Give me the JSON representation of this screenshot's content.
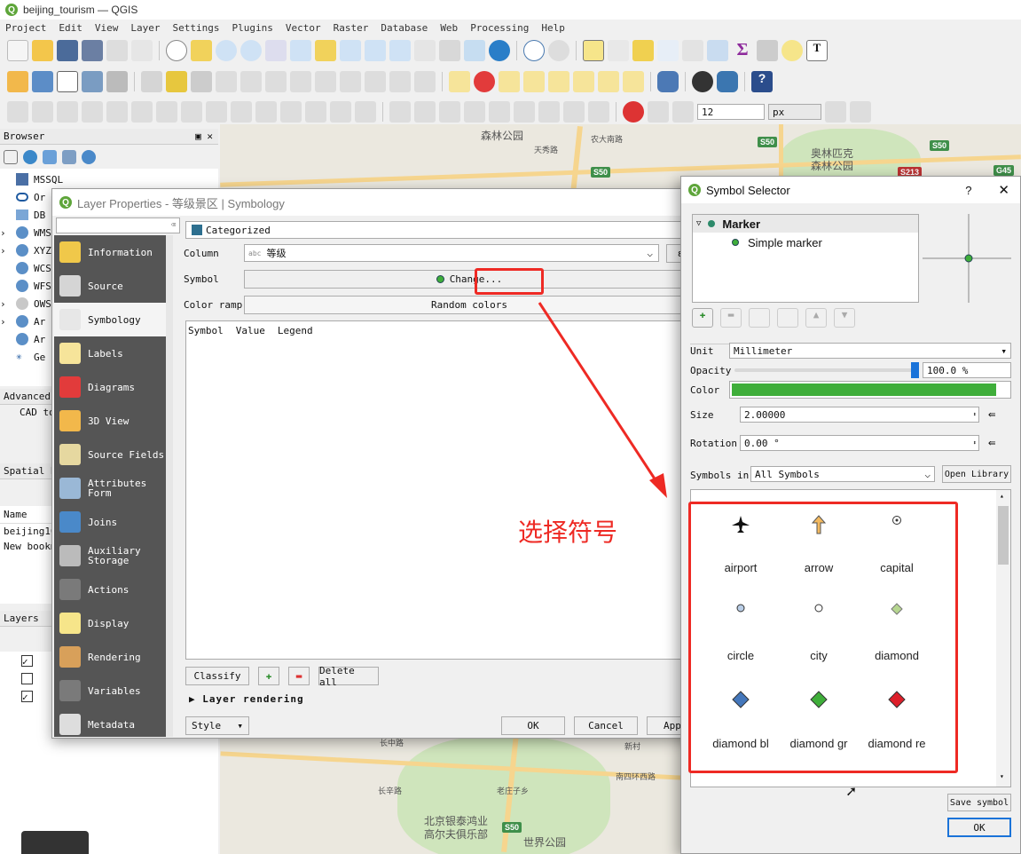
{
  "window": {
    "title": "beijing_tourism — QGIS"
  },
  "menu": [
    "Project",
    "Edit",
    "View",
    "Layer",
    "Settings",
    "Plugins",
    "Vector",
    "Raster",
    "Database",
    "Web",
    "Processing",
    "Help"
  ],
  "toolbar": {
    "snap_tolerance": "12",
    "snap_unit": "px"
  },
  "map_labels": [
    "森林公园",
    "天秀路",
    "农大南路",
    "奥林匹克",
    "森林公园",
    "S50",
    "S50",
    "S50",
    "G45",
    "S213",
    "长中路",
    "新村",
    "南四环西路",
    "长辛路",
    "老庄子乡",
    "北京银泰鸿业",
    "高尔夫俱乐部",
    "S50",
    "世界公园"
  ],
  "browser": {
    "header": "Browser",
    "items": [
      "MSSQL",
      "Or",
      "DB",
      "WMS",
      "XYZ",
      "WCS",
      "WFS",
      "OWS",
      "Ar",
      "Ar",
      "Ge"
    ]
  },
  "advanced": {
    "header": "Advanced",
    "item": "CAD to"
  },
  "spatial": {
    "header": "Spatial B",
    "col_name": "Name",
    "rows": [
      "beijing10",
      "New bookm"
    ]
  },
  "layers": {
    "header": "Layers"
  },
  "layer_props": {
    "title": "Layer Properties - 等级景区 | Symbology",
    "sidebar": [
      {
        "label": "Information",
        "icon": "info-icon"
      },
      {
        "label": "Source",
        "icon": "source-icon"
      },
      {
        "label": "Symbology",
        "icon": "symbology-icon"
      },
      {
        "label": "Labels",
        "icon": "labels-icon"
      },
      {
        "label": "Diagrams",
        "icon": "diagrams-icon"
      },
      {
        "label": "3D View",
        "icon": "cube-icon"
      },
      {
        "label": "Source Fields",
        "icon": "fields-icon"
      },
      {
        "label": "Attributes\nForm",
        "icon": "form-icon"
      },
      {
        "label": "Joins",
        "icon": "joins-icon"
      },
      {
        "label": "Auxiliary\nStorage",
        "icon": "storage-icon"
      },
      {
        "label": "Actions",
        "icon": "actions-icon"
      },
      {
        "label": "Display",
        "icon": "display-icon"
      },
      {
        "label": "Rendering",
        "icon": "rendering-icon"
      },
      {
        "label": "Variables",
        "icon": "variables-icon"
      },
      {
        "label": "Metadata",
        "icon": "metadata-icon"
      }
    ],
    "renderer": "Categorized",
    "column_label": "Column",
    "column_value": "等级",
    "column_type": "abc",
    "symbol_label": "Symbol",
    "change_button": "Change...",
    "color_ramp_label": "Color ramp",
    "color_ramp_value": "Random colors",
    "table_headers": [
      "Symbol",
      "Value",
      "Legend"
    ],
    "classify": "Classify",
    "delete_all": "Delete all",
    "layer_rendering": "Layer rendering",
    "style": "Style",
    "ok": "OK",
    "cancel": "Cancel",
    "apply": "Apply"
  },
  "annotation": "选择符号",
  "symbol_selector": {
    "title": "Symbol Selector",
    "help": "?",
    "tree_root": "Marker",
    "tree_child": "Simple marker",
    "unit_label": "Unit",
    "unit_value": "Millimeter",
    "opacity_label": "Opacity",
    "opacity_value": "100.0 %",
    "opacity_level": 1.0,
    "color_label": "Color",
    "color_value": "#3fae3a",
    "size_label": "Size",
    "size_value": "2.00000",
    "rotation_label": "Rotation",
    "rotation_value": "0.00 °",
    "symbols_in_label": "Symbols in",
    "symbols_in_value": "All Symbols",
    "open_library": "Open Library",
    "symbols": [
      {
        "name": "airport"
      },
      {
        "name": "arrow"
      },
      {
        "name": "capital"
      },
      {
        "name": "circle"
      },
      {
        "name": "city"
      },
      {
        "name": "diamond"
      },
      {
        "name": "diamond bl"
      },
      {
        "name": "diamond gr"
      },
      {
        "name": "diamond re"
      }
    ],
    "save_symbol": "Save symbol",
    "ok": "OK"
  },
  "colors": {
    "accent_red": "#ee2a24",
    "qgis_green": "#5ea53a",
    "marker_green": "#3fae3a"
  }
}
